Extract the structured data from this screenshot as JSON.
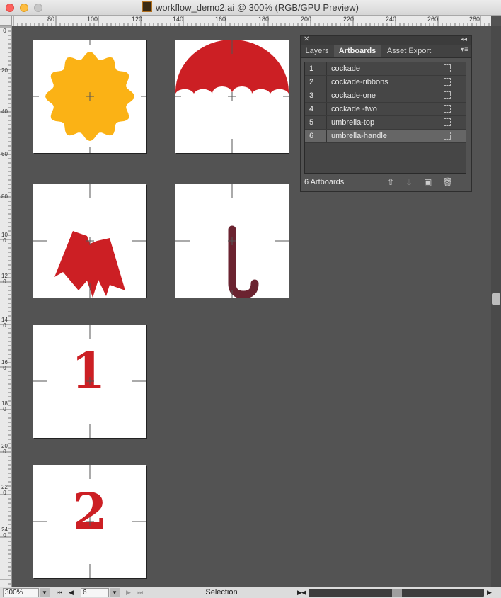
{
  "window": {
    "title": "workflow_demo2.ai @ 300% (RGB/GPU Preview)"
  },
  "ruler": {
    "h_labels": [
      "80",
      "100",
      "120",
      "140",
      "160",
      "180",
      "200",
      "220",
      "240",
      "260",
      "280"
    ],
    "v_labels": [
      "0",
      "20",
      "40",
      "60",
      "80",
      "100",
      "120",
      "140",
      "160",
      "180",
      "200",
      "220",
      "240"
    ]
  },
  "artboards_panel": {
    "tabs": [
      "Layers",
      "Artboards",
      "Asset Export"
    ],
    "active_tab": "Artboards",
    "rows": [
      {
        "num": "1",
        "name": "cockade"
      },
      {
        "num": "2",
        "name": "cockade-ribbons"
      },
      {
        "num": "3",
        "name": "cockade-one"
      },
      {
        "num": "4",
        "name": "cockade -two"
      },
      {
        "num": "5",
        "name": "umbrella-top"
      },
      {
        "num": "6",
        "name": "umbrella-handle"
      }
    ],
    "selected_row": "6",
    "count_label": "6 Artboards"
  },
  "artboard_art": {
    "cockade": {
      "color": "#FBB215"
    },
    "ribbons": {
      "color": "#CC1F24"
    },
    "one": {
      "text": "1",
      "color": "#CC1F24"
    },
    "two": {
      "text": "2",
      "color": "#CC1F24"
    },
    "umbrella_top": {
      "color": "#CC1F24"
    },
    "umbrella_handle": {
      "color": "#6B2330"
    }
  },
  "statusbar": {
    "zoom": "300%",
    "artboard_number": "6",
    "tool": "Selection"
  },
  "icons": {
    "move-up": "arrow-up-icon",
    "move-down": "arrow-down-icon",
    "new": "new-artboard-icon",
    "delete": "trash-icon"
  }
}
